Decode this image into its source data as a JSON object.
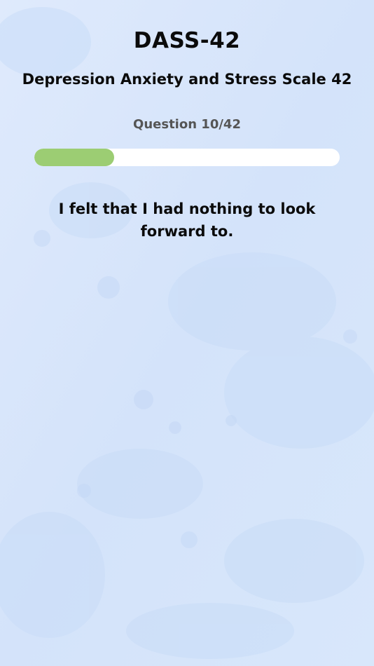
{
  "header": {
    "title": "DASS-42",
    "subtitle": "Depression Anxiety and Stress Scale 42"
  },
  "progress": {
    "label": "Question 10/42",
    "current": 10,
    "total": 42,
    "fraction": 0.262
  },
  "question": {
    "text": "I felt that I had nothing to look forward to."
  },
  "colors": {
    "progress_fill": "#9ccd73",
    "progress_track": "#ffffff",
    "background": "#d9e7fb"
  }
}
